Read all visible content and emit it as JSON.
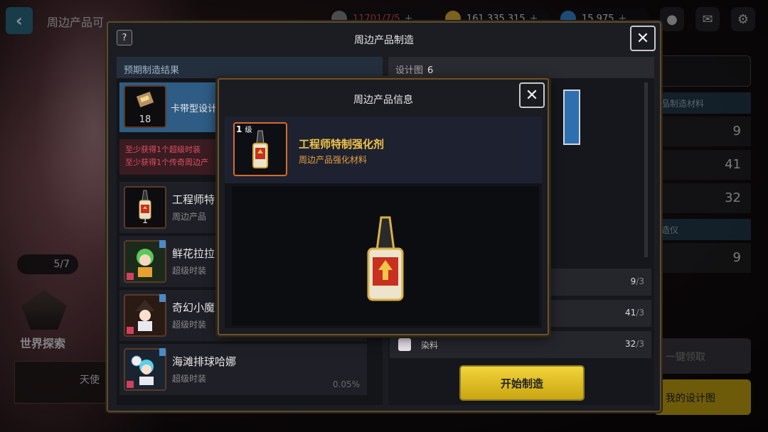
{
  "topbar": {
    "screen_title": "周边产品可",
    "currencies": [
      {
        "value": "11701/7/5",
        "color": "#e84a4a",
        "icon": "ticket-icon"
      },
      {
        "value": "161,335,315",
        "color": "#e8e8e8",
        "icon": "gold-coin-icon"
      },
      {
        "value": "15,975",
        "color": "#e8e8e8",
        "icon": "blue-gem-icon"
      }
    ],
    "icons": [
      "chat-icon",
      "mail-icon",
      "settings-icon"
    ]
  },
  "background": {
    "count_badge": "5/7",
    "explore_label": "世界探索",
    "angel_label": "天使",
    "right_rows": [
      "9",
      "41",
      "32",
      "9"
    ],
    "right_head_1": "品制造材料",
    "right_head_2": "造仪",
    "right_btn_1": "一键领取",
    "right_btn_2": "我的设计图"
  },
  "main": {
    "title": "周边产品制造",
    "help": "?",
    "close": "✕",
    "left": {
      "header": "预期制造结果",
      "design": {
        "name": "卡带型设计",
        "count": "18"
      },
      "warnings": [
        "至少获得1个超级时装",
        "至少获得1个传奇周边产"
      ],
      "items": [
        {
          "name": "工程师特",
          "sub": "周边产品",
          "count": "1",
          "pct": ""
        },
        {
          "name": "鲜花拉拉",
          "sub": "超级时装",
          "count": "",
          "pct": ""
        },
        {
          "name": "奇幻小魔",
          "sub": "超级时装",
          "count": "",
          "pct": ""
        },
        {
          "name": "海滩排球哈娜",
          "sub": "超级时装",
          "count": "",
          "pct": "0.05%"
        }
      ]
    },
    "right": {
      "header_label": "设计图",
      "header_count": "6",
      "materials": [
        {
          "name": "",
          "have": "9",
          "need": "/3"
        },
        {
          "name": "",
          "have": "41",
          "need": "/3"
        },
        {
          "name": "染料",
          "have": "32",
          "need": "/3"
        }
      ],
      "start_button": "开始制造"
    }
  },
  "info": {
    "title": "周边产品信息",
    "close": "✕",
    "level_num": "1",
    "level_unit": "级",
    "item_name": "工程师特制强化剂",
    "item_sub": "周边产品强化材料"
  },
  "colors": {
    "accent_gold": "#f2d43a",
    "frame_brown": "#6a5230",
    "design_blue": "#2f5c84"
  }
}
